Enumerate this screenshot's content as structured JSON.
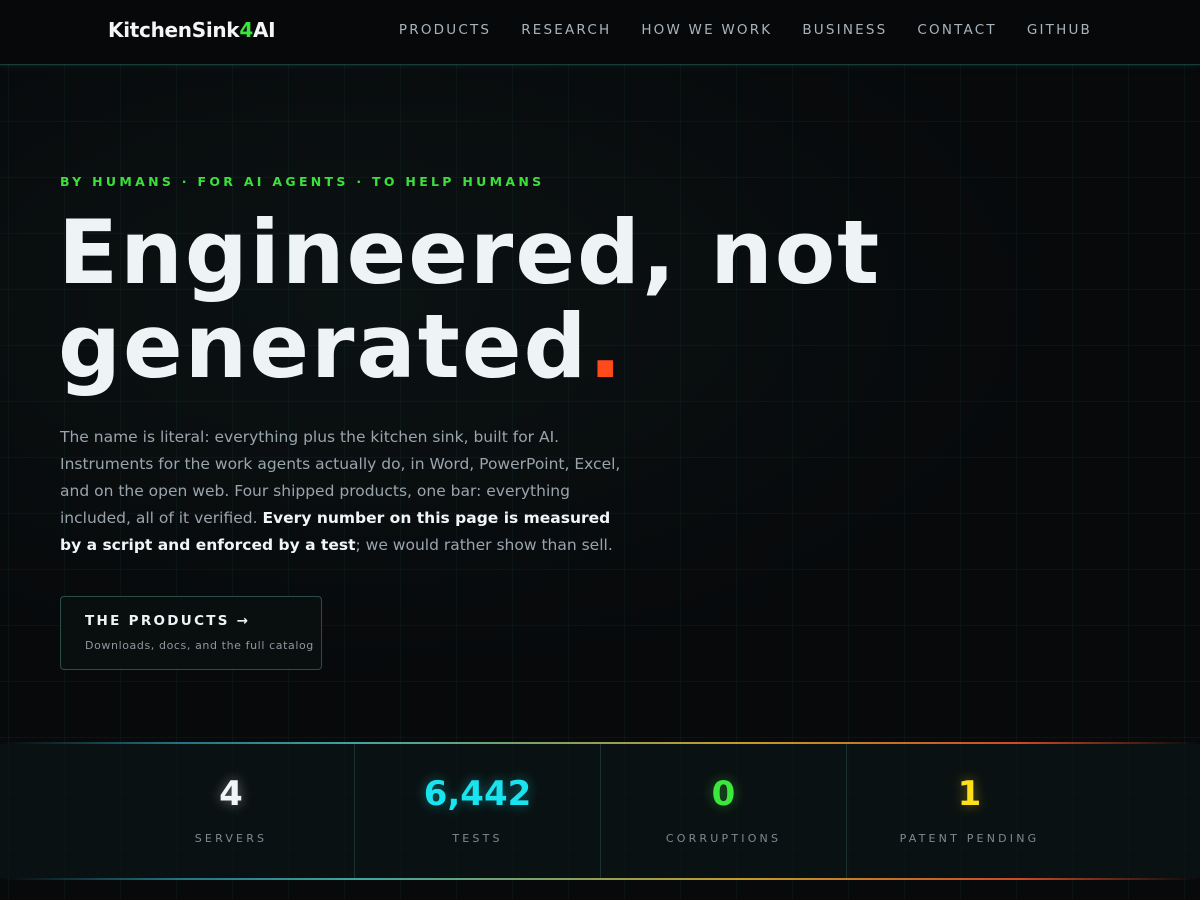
{
  "header": {
    "logo_prefix": "KitchenSink",
    "logo_four": "4",
    "logo_suffix": "AI",
    "nav": [
      "PRODUCTS",
      "RESEARCH",
      "HOW WE WORK",
      "BUSINESS",
      "CONTACT",
      "GITHUB"
    ]
  },
  "hero": {
    "eyebrow": "BY HUMANS · FOR AI AGENTS · TO HELP HUMANS",
    "title_line1": "Engineered, not",
    "title_line2": "generated",
    "title_dot": ".",
    "lede_part1": "The name is literal: everything plus the kitchen sink, built for AI. Instruments for the work agents actually do, in Word, PowerPoint, Excel, and on the open web. Four shipped products, one bar: everything included, all of it verified.",
    "lede_bold": "Every number on this page is measured by a script and enforced by a test",
    "lede_part2": "; we would rather show than sell.",
    "cta_title": "THE PRODUCTS →",
    "cta_sub": "Downloads, docs, and the full catalog"
  },
  "stats": [
    {
      "value": "4",
      "label": "SERVERS",
      "color": "#f2f5f7"
    },
    {
      "value": "6,442",
      "label": "TESTS",
      "color": "#19e3ee"
    },
    {
      "value": "0",
      "label": "CORRUPTIONS",
      "color": "#3be83b"
    },
    {
      "value": "1",
      "label": "PATENT PENDING",
      "color": "#ffdf1a"
    }
  ],
  "colors": {
    "accent_green": "#39e639",
    "accent_orange": "#ff4a1c",
    "background": "#07090b"
  }
}
